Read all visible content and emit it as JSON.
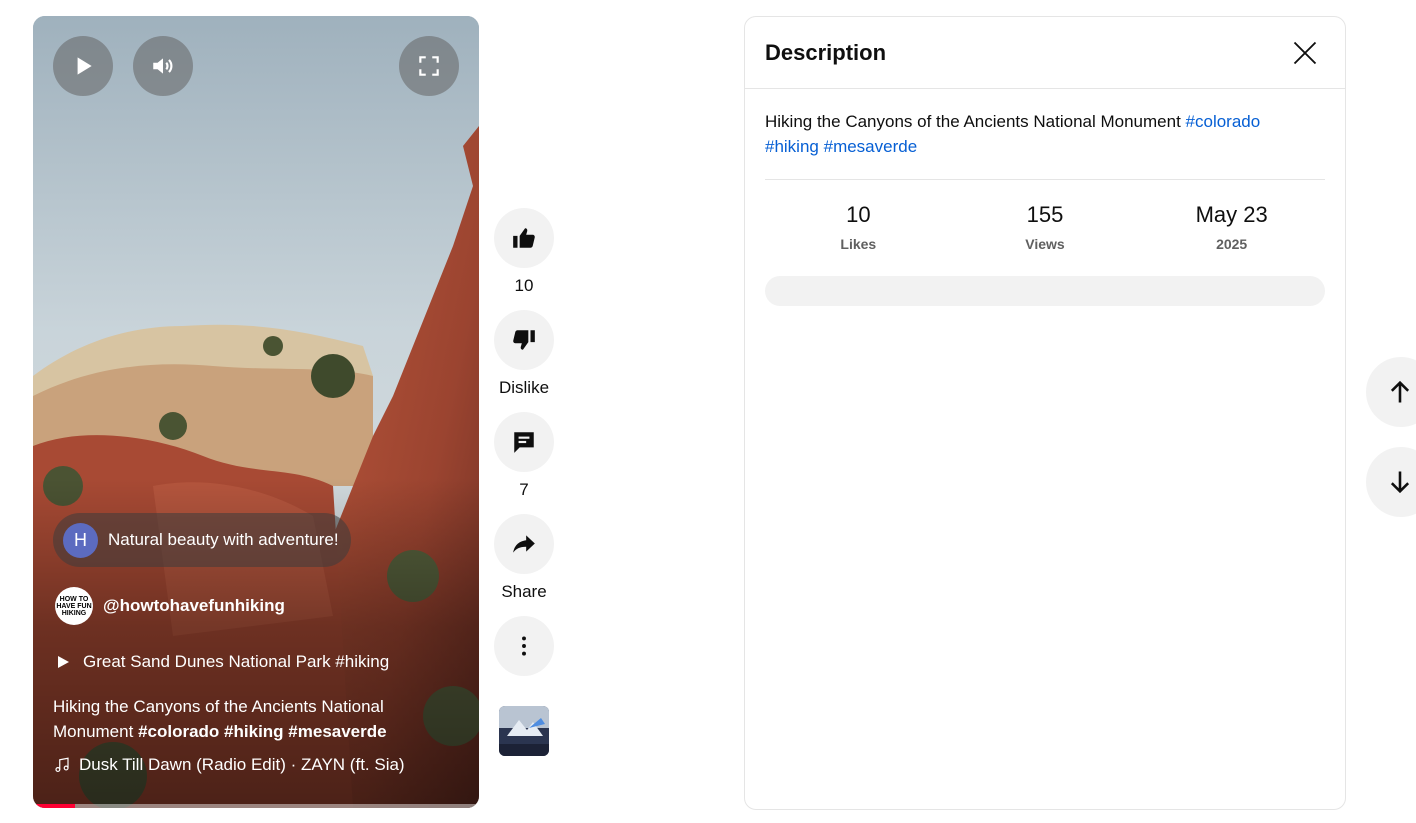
{
  "player": {
    "comment_chip": {
      "avatar_letter": "H",
      "text": "Natural beauty with adventure!"
    },
    "channel": {
      "logo_text": "HOW TO HAVE FUN HIKING",
      "handle": "@howtohavefunhiking"
    },
    "playlist": {
      "title": "Great Sand Dunes National Park #hiking"
    },
    "caption": {
      "text": "Hiking the Canyons of the Ancients National Monument",
      "tags": [
        "#colorado",
        "#hiking",
        "#mesaverde"
      ]
    },
    "music": {
      "track": "Dusk Till Dawn (Radio Edit) · ZAYN (ft. Sia)"
    },
    "progress": 0.095,
    "controls": {
      "play_icon": "play-icon",
      "volume_icon": "volume-icon",
      "fullscreen_icon": "fullscreen-icon"
    }
  },
  "actions": {
    "like": {
      "label": "10",
      "icon": "thumbs-up-icon"
    },
    "dislike": {
      "label": "Dislike",
      "icon": "thumbs-down-icon"
    },
    "comments": {
      "label": "7",
      "icon": "comment-icon"
    },
    "share": {
      "label": "Share",
      "icon": "share-icon"
    },
    "more": {
      "icon": "more-vertical-icon"
    }
  },
  "description_panel": {
    "title": "Description",
    "text": "Hiking the Canyons of the Ancients National Monument",
    "tags": [
      "#colorado",
      "#hiking",
      "#mesaverde"
    ],
    "stats": [
      {
        "value": "10",
        "label": "Likes"
      },
      {
        "value": "155",
        "label": "Views"
      },
      {
        "value": "May 23",
        "label": "2025"
      }
    ]
  },
  "colors": {
    "progress": "#ff0033",
    "hashtag_link": "#065fd4",
    "button_bg": "#f2f2f2"
  }
}
